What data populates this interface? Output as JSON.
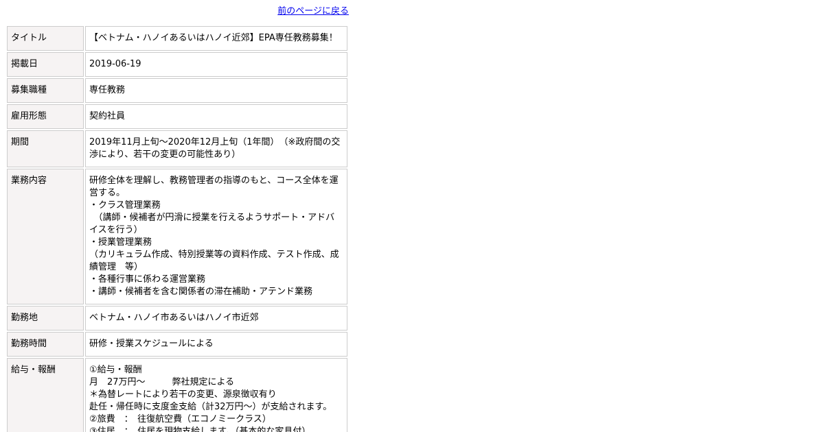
{
  "back_link": "前のページに戻る",
  "rows": [
    {
      "label": "タイトル",
      "value": "【ベトナム・ハノイあるいはハノイ近郊】EPA専任教務募集！"
    },
    {
      "label": "掲載日",
      "value": "2019-06-19"
    },
    {
      "label": "募集職種",
      "value": "専任教務"
    },
    {
      "label": "雇用形態",
      "value": "契約社員"
    },
    {
      "label": "期間",
      "value": "2019年11月上旬～2020年12月上旬（1年間）　（※政府間の交渉により、若干の変更の可能性あり）"
    },
    {
      "label": "業務内容",
      "value": "研修全体を理解し、教務管理者の指導のもと、コース全体を運営する。\n・クラス管理業務\n　（講師・候補者が円滑に授業を行えるようサポート・アドバイスを行う）\n・授業管理業務\n（カリキュラム作成、特別授業等の資料作成、テスト作成、成績管理　等）\n・各種行事に係わる運営業務\n・講師・候補者を含む関係者の滞在補助・アテンド業務"
    },
    {
      "label": "勤務地",
      "value": "ベトナム・ハノイ市あるいはハノイ市近郊"
    },
    {
      "label": "勤務時間",
      "value": "研修・授業スケジュールによる"
    },
    {
      "label": "給与・報酬",
      "value": "①給与・報酬\n月　27万円～　　　弊社規定による\n＊為替レートにより若干の変更、源泉徴収有り\n赴任・帰任時に支度金支給（計32万円～）が支給されます。\n②旅費　：　往復航空費（エコノミークラス）\n③住居　：　住居を現物支給します。（基本的な家具付）"
    }
  ]
}
